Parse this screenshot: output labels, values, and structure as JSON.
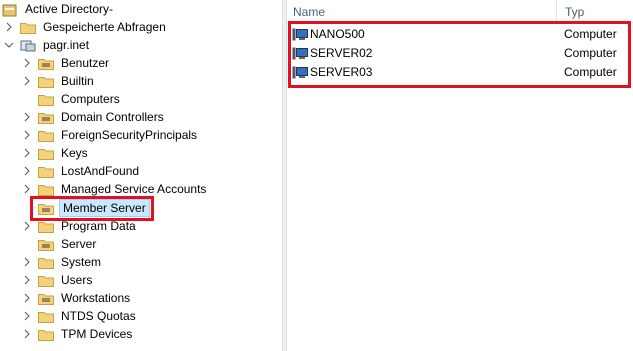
{
  "tree": {
    "root_label": "Active Directory-",
    "items": [
      {
        "label": "Gespeicherte Abfragen"
      },
      {
        "label": "pagr.inet"
      },
      {
        "label": "Benutzer"
      },
      {
        "label": "Builtin"
      },
      {
        "label": "Computers"
      },
      {
        "label": "Domain Controllers"
      },
      {
        "label": "ForeignSecurityPrincipals"
      },
      {
        "label": "Keys"
      },
      {
        "label": "LostAndFound"
      },
      {
        "label": "Managed Service Accounts"
      },
      {
        "label": "Member Server"
      },
      {
        "label": "Program Data"
      },
      {
        "label": "Server"
      },
      {
        "label": "System"
      },
      {
        "label": "Users"
      },
      {
        "label": "Workstations"
      },
      {
        "label": "NTDS Quotas"
      },
      {
        "label": "TPM Devices"
      }
    ]
  },
  "list": {
    "columns": {
      "name": "Name",
      "type": "Typ"
    },
    "rows": [
      {
        "name": "NANO500",
        "type": "Computer"
      },
      {
        "name": "SERVER02",
        "type": "Computer"
      },
      {
        "name": "SERVER03",
        "type": "Computer"
      }
    ]
  },
  "colors": {
    "highlight": "#e3101f",
    "selection": "#cce8ff"
  },
  "icons": [
    "folder-icon",
    "domain-icon",
    "computer-icon",
    "chevron-right-icon",
    "chevron-down-icon"
  ]
}
